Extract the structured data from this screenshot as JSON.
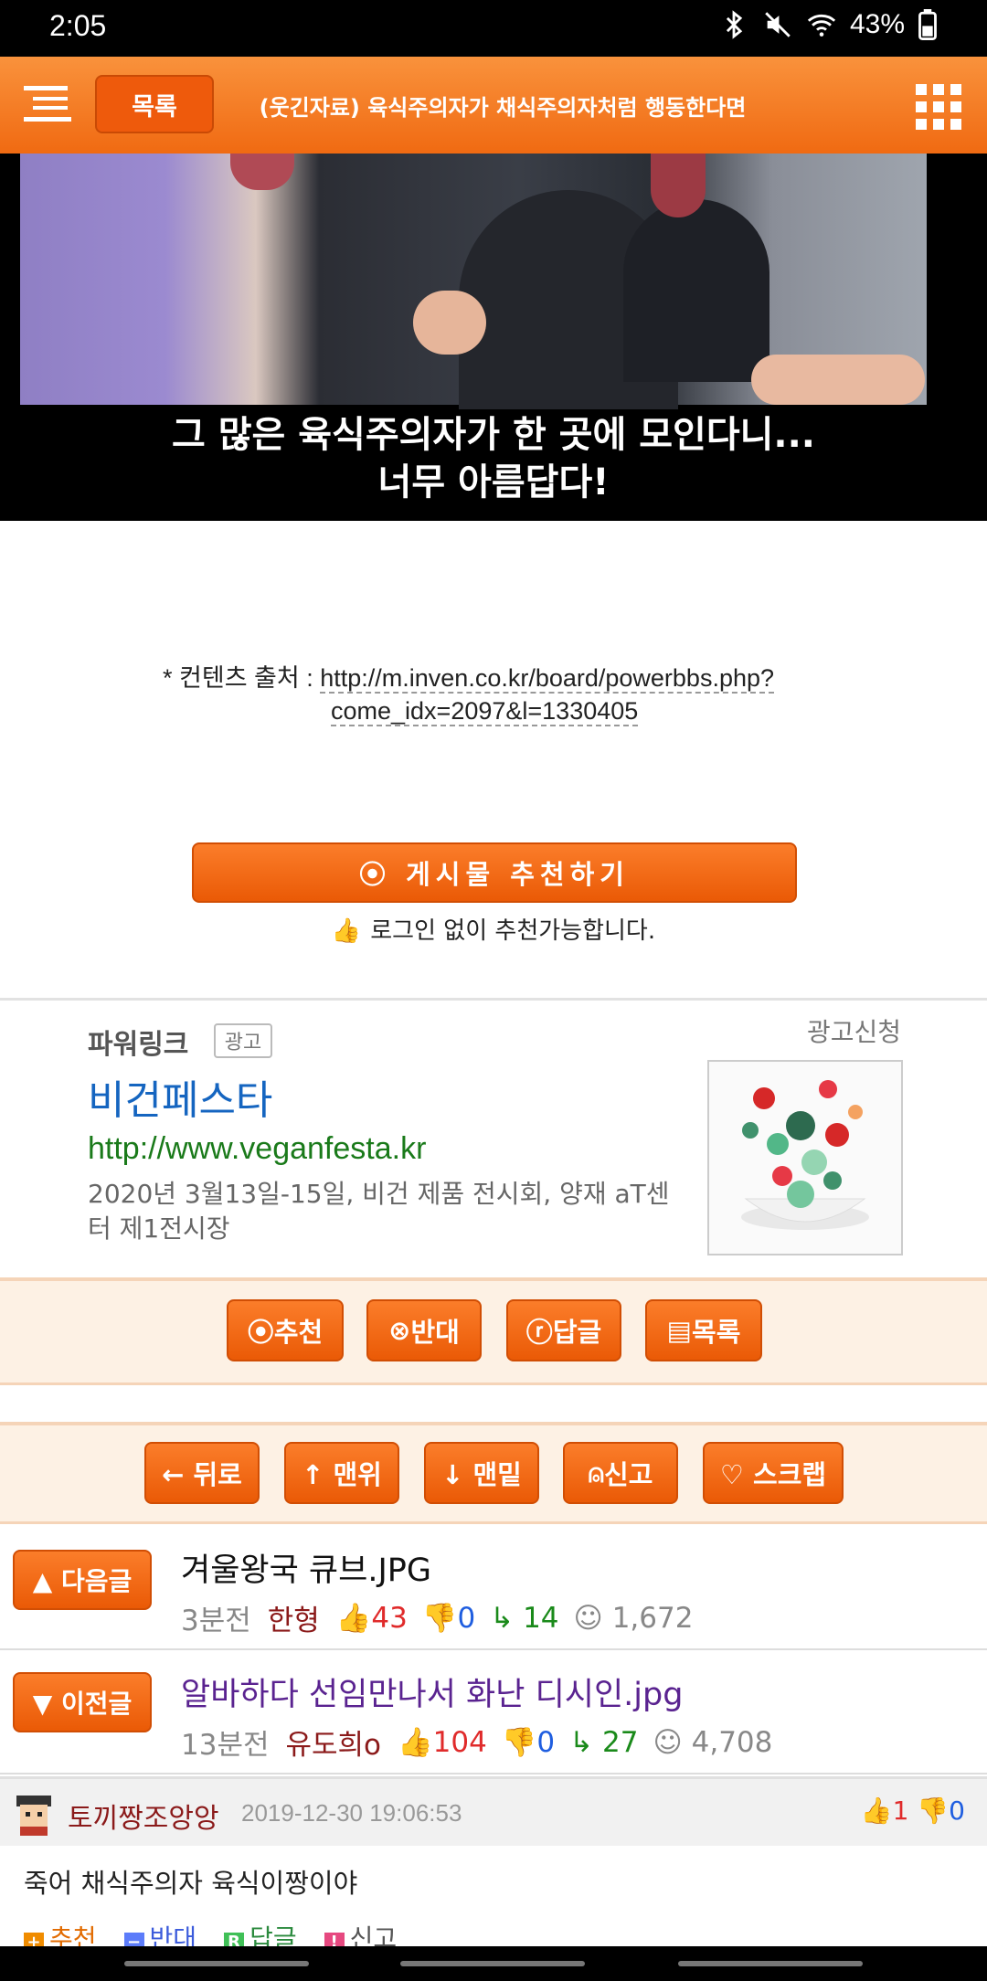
{
  "status_bar": {
    "time": "2:05",
    "battery": "43%"
  },
  "top_nav": {
    "list_label": "목록",
    "title": "(웃긴자료) 육식주의자가 채식주의자처럼 행동한다면"
  },
  "video": {
    "subtitle_line1": "그 많은 육식주의자가 한 곳에 모인다니...",
    "subtitle_line2": "너무 아름답다!"
  },
  "source": {
    "label": "* 컨텐츠 출처 :",
    "url_line1": "http://m.inven.co.kr/board/powerbbs.php?",
    "url_line2": "come_idx=2097&l=1330405"
  },
  "recommend": {
    "button_label": "⦿ 게시물  추천하기",
    "note": "로그인 없이 추천가능합니다."
  },
  "ad": {
    "header": "파워링크",
    "tag": "광고",
    "apply": "광고신청",
    "title": "비건페스타",
    "url": "http://www.veganfesta.kr",
    "desc": "2020년 3월13일-15일, 비건 제품 전시회, 양재 aT센터 제1전시장"
  },
  "action_bar": {
    "recommend": "추천",
    "oppose": "반대",
    "reply": "답글",
    "list": "목록"
  },
  "nav_bar": {
    "back": "← 뒤로",
    "top": "↑ 맨위",
    "bottom": "↓ 맨밑",
    "report": "신고",
    "scrap": "♡ 스크랩"
  },
  "next_post": {
    "button": "▲ 다음글",
    "title": "겨울왕국 큐브.JPG",
    "time": "3분전",
    "author": "한형",
    "up": "43",
    "down": "0",
    "replies": "14",
    "views": "1,672"
  },
  "prev_post": {
    "button": "▼ 이전글",
    "title": "알바하다 선임만나서 화난 디시인.jpg",
    "time": "13분전",
    "author": "유도희o",
    "up": "104",
    "down": "0",
    "replies": "27",
    "views": "4,708"
  },
  "comment": {
    "user": "토끼짱조앙앙",
    "date": "2019-12-30 19:06:53",
    "up": "1",
    "down": "0",
    "body": "죽어 채식주의자 육식이짱이야",
    "actions": {
      "recommend": "추천",
      "oppose": "반대",
      "reply": "답글",
      "report": "신고"
    }
  },
  "colors": {
    "accent": "#f06a12",
    "link_blue": "#1565c0",
    "url_green": "#1a7a1a",
    "up_red": "#e02b2b",
    "down_blue": "#1f5ee0"
  }
}
